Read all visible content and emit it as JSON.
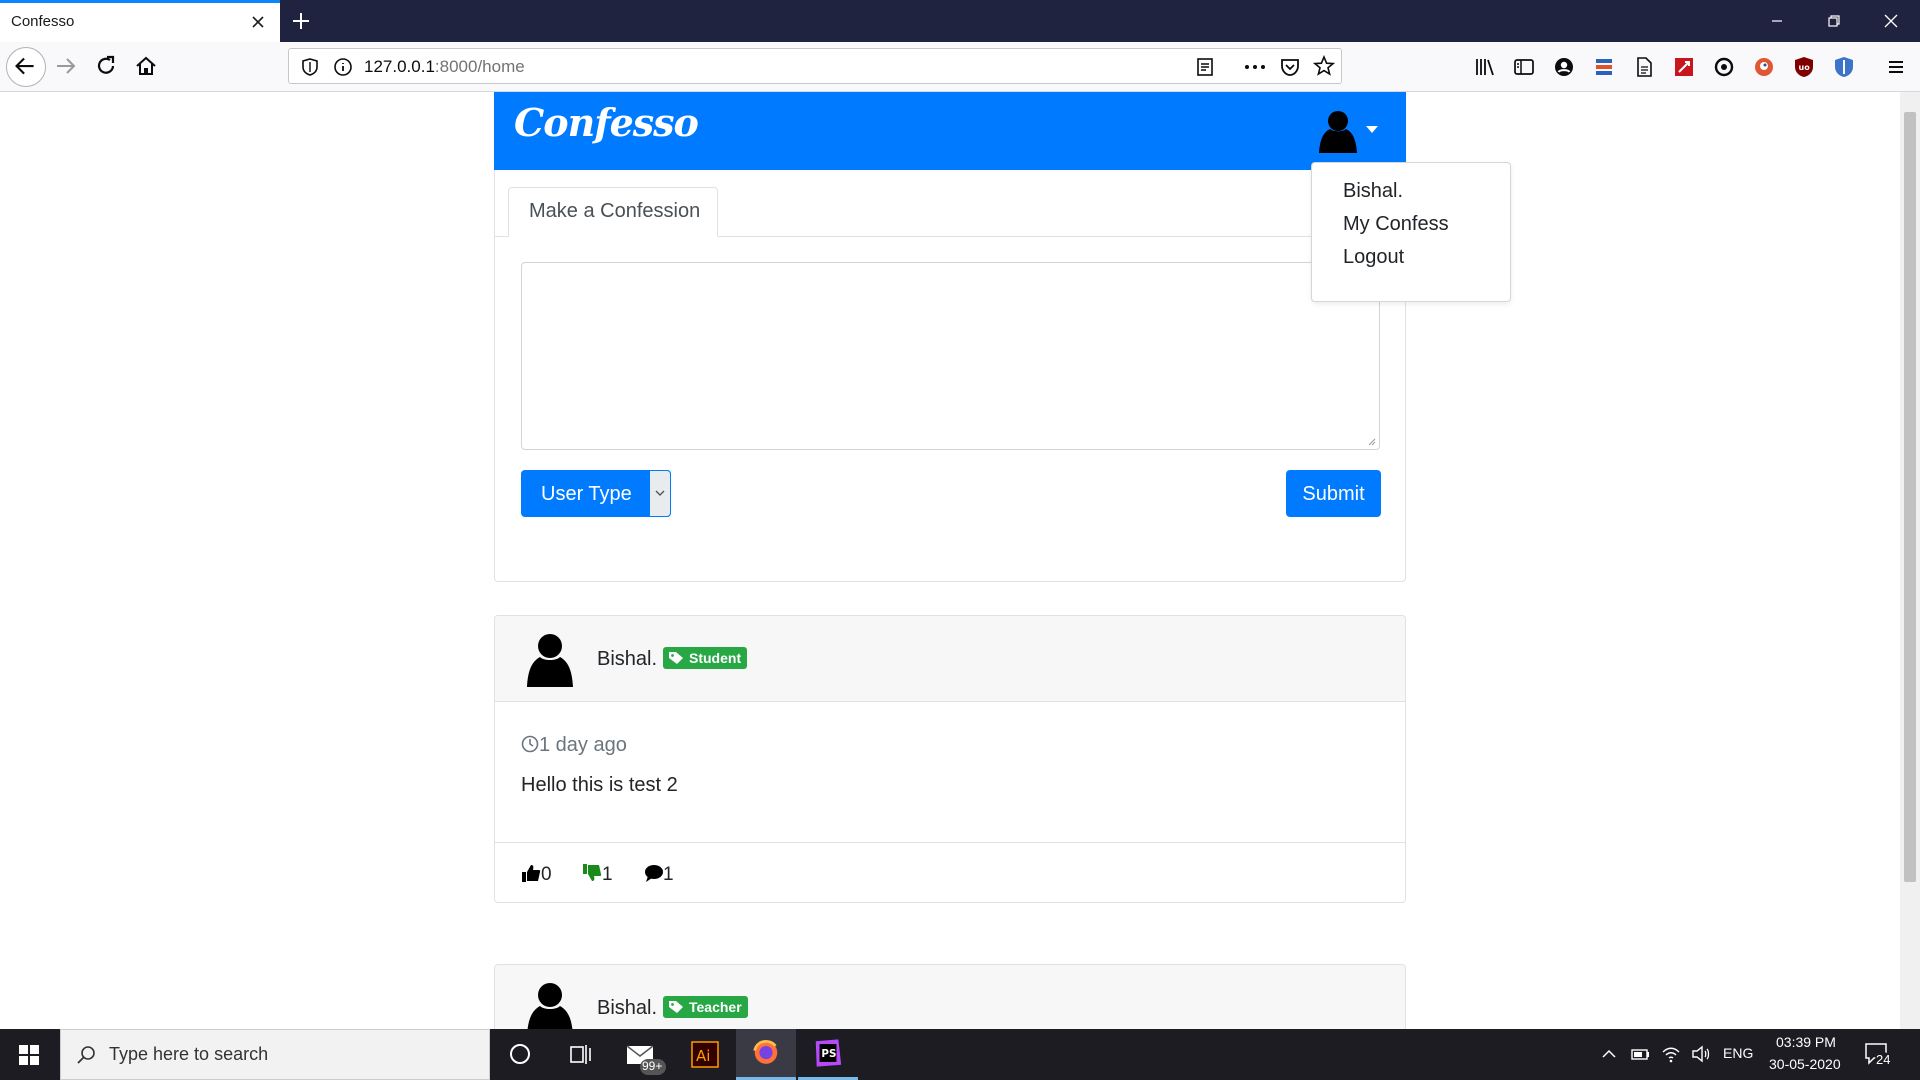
{
  "browser": {
    "tab_title": "Confesso",
    "url_host": "127.0.0.1",
    "url_rest": ":8000/home"
  },
  "site": {
    "brand": "Confesso",
    "accent_color": "#007bff"
  },
  "user_menu": {
    "items": [
      "Bishal.",
      "My Confess",
      "Logout"
    ]
  },
  "confess_form": {
    "tab_label": "Make a Confession",
    "textarea_value": "",
    "user_type_label": "User Type",
    "submit_label": "Submit"
  },
  "posts": [
    {
      "author": "Bishal.",
      "badge": "Student",
      "time": "1 day ago",
      "body": "Hello this is test 2",
      "likes": "0",
      "dislikes": "1",
      "comments": "1"
    },
    {
      "author": "Bishal.",
      "badge": "Teacher"
    }
  ],
  "taskbar": {
    "search_placeholder": "Type here to search",
    "mail_badge": "99+",
    "language": "ENG",
    "time": "03:39 PM",
    "date": "30-05-2020",
    "notifications": "24"
  }
}
